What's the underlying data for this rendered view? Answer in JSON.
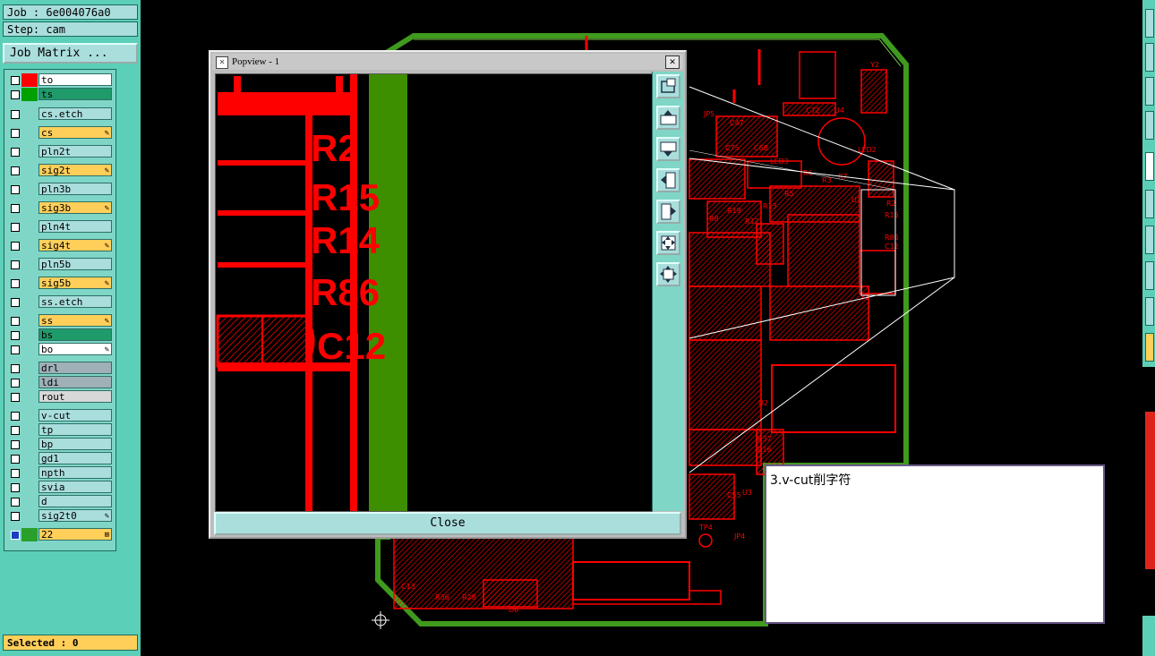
{
  "job_label": "Job : 6e004076a0",
  "step_label": "Step: cam",
  "job_matrix_label": "Job Matrix ...",
  "layers": [
    {
      "name": "to",
      "swatch": "#ff0000",
      "bg": "#ffffff",
      "tag": ""
    },
    {
      "name": "ts",
      "swatch": "#00a000",
      "bg": "#1f9a6a",
      "tag": ""
    },
    {
      "name": "cs.etch",
      "swatch": "",
      "bg": "#a9dedd",
      "tag": ""
    },
    {
      "name": "cs",
      "swatch": "",
      "bg": "#ffcf5a",
      "tag": "✎"
    },
    {
      "name": "pln2t",
      "swatch": "",
      "bg": "#a9dedd",
      "tag": ""
    },
    {
      "name": "sig2t",
      "swatch": "",
      "bg": "#ffcf5a",
      "tag": "✎"
    },
    {
      "name": "pln3b",
      "swatch": "",
      "bg": "#a9dedd",
      "tag": ""
    },
    {
      "name": "sig3b",
      "swatch": "",
      "bg": "#ffcf5a",
      "tag": "✎"
    },
    {
      "name": "pln4t",
      "swatch": "",
      "bg": "#a9dedd",
      "tag": ""
    },
    {
      "name": "sig4t",
      "swatch": "",
      "bg": "#ffcf5a",
      "tag": "✎"
    },
    {
      "name": "pln5b",
      "swatch": "",
      "bg": "#a9dedd",
      "tag": ""
    },
    {
      "name": "sig5b",
      "swatch": "",
      "bg": "#ffcf5a",
      "tag": "✎"
    },
    {
      "name": "ss.etch",
      "swatch": "",
      "bg": "#a9dedd",
      "tag": ""
    },
    {
      "name": "ss",
      "swatch": "",
      "bg": "#ffcf5a",
      "tag": "✎"
    },
    {
      "name": "bs",
      "swatch": "",
      "bg": "#1f9a6a",
      "tag": ""
    },
    {
      "name": "bo",
      "swatch": "",
      "bg": "#ffffff",
      "tag": "✎"
    },
    {
      "name": "drl",
      "swatch": "",
      "bg": "#9fb0b6",
      "tag": ""
    },
    {
      "name": "ldi",
      "swatch": "",
      "bg": "#9fb0b6",
      "tag": ""
    },
    {
      "name": "rout",
      "swatch": "",
      "bg": "#d8d8d8",
      "tag": ""
    },
    {
      "name": "v-cut",
      "swatch": "",
      "bg": "#a9dedd",
      "tag": ""
    },
    {
      "name": "tp",
      "swatch": "",
      "bg": "#a9dedd",
      "tag": ""
    },
    {
      "name": "bp",
      "swatch": "",
      "bg": "#a9dedd",
      "tag": ""
    },
    {
      "name": "gd1",
      "swatch": "",
      "bg": "#a9dedd",
      "tag": ""
    },
    {
      "name": "npth",
      "swatch": "",
      "bg": "#a9dedd",
      "tag": ""
    },
    {
      "name": "svia",
      "swatch": "",
      "bg": "#a9dedd",
      "tag": ""
    },
    {
      "name": "d",
      "swatch": "",
      "bg": "#a9dedd",
      "tag": ""
    },
    {
      "name": "sig2t0",
      "swatch": "",
      "bg": "#a9dedd",
      "tag": "✎"
    },
    {
      "name": "22",
      "swatch": "#2aa02a",
      "bg": "#ffcf5a",
      "tag": "⊞"
    }
  ],
  "selected_label": "Selected : 0",
  "popview": {
    "title": "Popview - 1",
    "close_label": "Close",
    "designators": [
      "R2",
      "R15",
      "R14",
      "R86",
      "C12"
    ]
  },
  "note_text": "3.v-cut削字符",
  "board_labels": {
    "led3": "LED3",
    "r6": "R6",
    "r7": "R7",
    "r3": "R3",
    "r5": "R5",
    "jp5": "JP5",
    "c72": "C72",
    "u4": "U4",
    "y2": "Y2",
    "c47": "C47",
    "c75": "C75",
    "c68": "C68",
    "r12": "R12",
    "r8": "R8",
    "r13": "R13",
    "r19": "R19",
    "y1": "Y1",
    "u2": "U2",
    "u3": "U3",
    "c55": "C55",
    "tp4": "TP4",
    "jp4": "JP4",
    "d6": "D6",
    "c13": "C13",
    "r36": "R36",
    "r28": "R28",
    "r37": "R37",
    "r16": "R16",
    "u1": "U1",
    "r2": "R2",
    "r15": "R15",
    "r86": "R86",
    "c12": "C12",
    "led2": "LED2"
  },
  "colors": {
    "panel": "#5ccfb8",
    "board_outline": "#3f9a1e",
    "trace": "#ff0000",
    "vcut": "#3e8f00"
  }
}
